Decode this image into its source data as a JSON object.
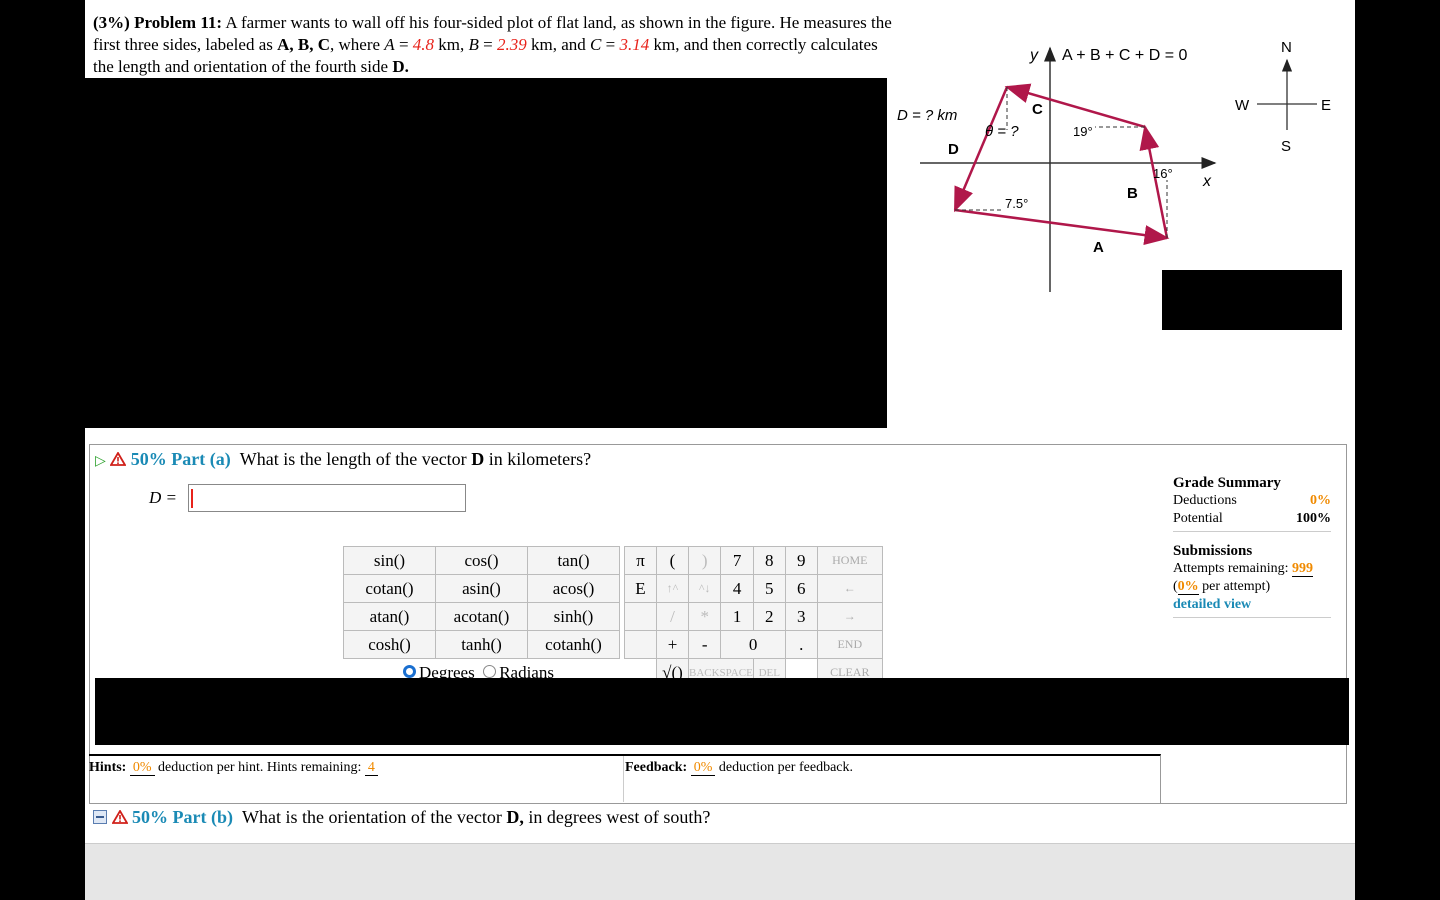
{
  "problem": {
    "weight": "(3%)",
    "number": "Problem 11:",
    "text_1": "A farmer wants to wall off his four-sided plot of flat land, as shown in the figure. He measures the first three sides, labeled as",
    "labels": "A, B, C",
    "text_2": "where",
    "A_value": "4.8",
    "B_value": "2.39",
    "C_value": "3.14",
    "unit": "km",
    "text_3": "and then correctly calculates the length and orientation of the fourth side",
    "D_label": "D."
  },
  "diagram": {
    "equation": "A + B + C + D = 0",
    "y_axis": "y",
    "x_axis": "x",
    "D_km": "D = ? km",
    "theta": "θ = ?",
    "angle_19": "19°",
    "angle_16": "16°",
    "angle_7_5": "7.5°",
    "label_A": "A",
    "label_B": "B",
    "label_C": "C",
    "label_D": "D",
    "compass": {
      "N": "N",
      "S": "S",
      "E": "E",
      "W": "W"
    }
  },
  "part_a": {
    "weight": "50%",
    "name": "Part (a)",
    "question_1": "What is the length of the vector",
    "vector": "D",
    "question_2": "in kilometers?",
    "answer_label": "D =",
    "answer_value": ""
  },
  "keypad": {
    "functions": [
      [
        "sin()",
        "cos()",
        "tan()"
      ],
      [
        "cotan()",
        "asin()",
        "acos()"
      ],
      [
        "atan()",
        "acotan()",
        "sinh()"
      ],
      [
        "cosh()",
        "tanh()",
        "cotanh()"
      ]
    ],
    "pi": "π",
    "E": "E",
    "open_paren": "(",
    "close_paren": ")",
    "up": "↑^",
    "down": "^↓",
    "slash": "/",
    "star": "*",
    "plus": "+",
    "minus": "-",
    "sqrt": "√()",
    "digits": [
      "7",
      "8",
      "9",
      "4",
      "5",
      "6",
      "1",
      "2",
      "3",
      "0",
      "."
    ],
    "home": "HOME",
    "left_arrow": "←",
    "right_arrow": "→",
    "end": "END",
    "backspace": "BACKSPACE",
    "del": "DEL",
    "clear": "CLEAR",
    "degrees": "Degrees",
    "radians": "Radians"
  },
  "grade": {
    "title": "Grade Summary",
    "deductions_label": "Deductions",
    "deductions_value": "0%",
    "potential_label": "Potential",
    "potential_value": "100%",
    "submissions_title": "Submissions",
    "attempts_label": "Attempts remaining:",
    "attempts_value": "999",
    "per_attempt_open": "(",
    "per_attempt_value": "0%",
    "per_attempt_label": "per attempt)",
    "detailed_view": "detailed view"
  },
  "hints": {
    "label": "Hints:",
    "pct": "0%",
    "text": "deduction per hint. Hints remaining:",
    "remaining": "4"
  },
  "feedback": {
    "label": "Feedback:",
    "pct": "0%",
    "text": "deduction per feedback."
  },
  "part_b": {
    "weight": "50%",
    "name": "Part (b)",
    "question_1": "What is the orientation of the vector",
    "vector": "D,",
    "question_2": "in degrees west of south?"
  }
}
